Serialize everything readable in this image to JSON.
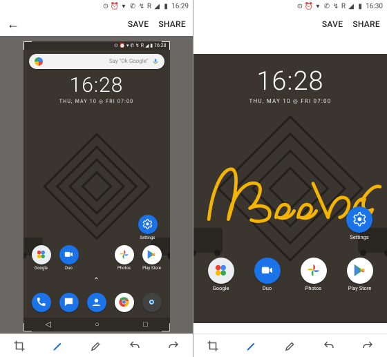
{
  "left": {
    "device_status": {
      "time": "16:29",
      "label_r": "R"
    },
    "editor": {
      "save": "SAVE",
      "share": "SHARE"
    },
    "shot": {
      "status": {
        "time": "16:28",
        "label_r": "R"
      },
      "search": {
        "placeholder": "Say \"Ok Google\""
      },
      "clock": {
        "time": "16:28",
        "date": "THU, MAY 10 ◎ FRI 07:00"
      },
      "apps": {
        "settings": "Settings",
        "google": "Google",
        "duo": "Duo",
        "photos": "Photos",
        "play": "Play Store"
      }
    }
  },
  "right": {
    "device_status": {
      "time": "16:30",
      "label_r": "R"
    },
    "editor": {
      "save": "SAVE",
      "share": "SHARE"
    },
    "annotation_text": "Beebom",
    "annotation_color": "#f5b400",
    "shot": {
      "clock": {
        "time": "16:28",
        "date": "THU, MAY 10 ◎ FRI 07:00"
      },
      "apps": {
        "settings": "Settings",
        "google": "Google",
        "duo": "Duo",
        "photos": "Photos",
        "play": "Play Store"
      }
    }
  },
  "icons": {
    "alarm": "alarm-icon",
    "wifi": "wifi-icon",
    "vibrate": "vibrate-icon",
    "phone": "phone-icon",
    "signal": "signal-icon",
    "battery": "battery-icon",
    "back": "back-arrow-icon",
    "pen": "pen-tool-icon",
    "highlighter": "highlighter-tool-icon",
    "undo": "undo-icon",
    "redo": "redo-icon",
    "crop": "crop-tool-icon",
    "nav_back": "nav-back-icon",
    "nav_home": "nav-home-icon",
    "nav_recent": "nav-recent-icon",
    "mic": "mic-icon",
    "caret": "caret-up-icon"
  }
}
